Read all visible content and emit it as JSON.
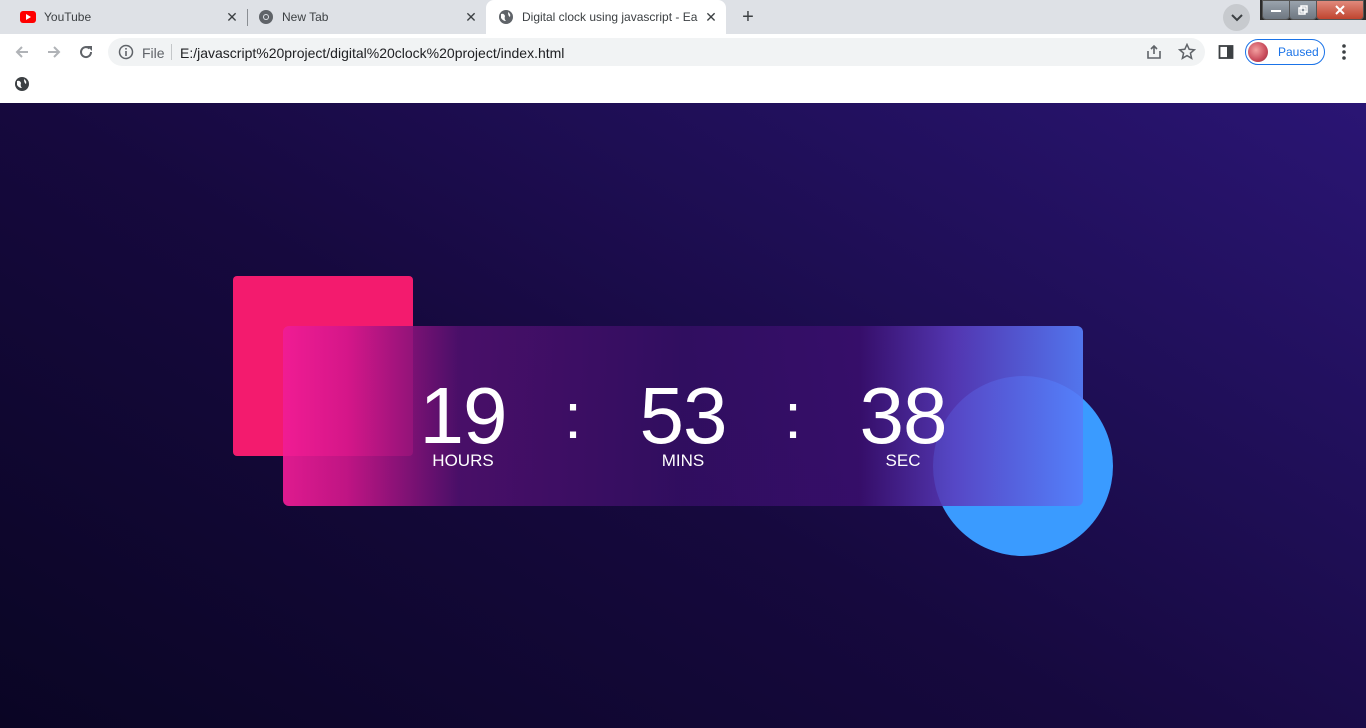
{
  "browser": {
    "tabs": [
      {
        "title": "YouTube",
        "icon": "youtube-icon"
      },
      {
        "title": "New Tab",
        "icon": "chrome-icon"
      },
      {
        "title": "Digital clock using javascript - Ea",
        "icon": "globe-icon",
        "active": true
      }
    ],
    "omnibox": {
      "scheme_label": "File",
      "url": "E:/javascript%20project/digital%20clock%20project/index.html"
    },
    "profile": {
      "label": "Paused"
    }
  },
  "clock": {
    "hours": "19",
    "hours_label": "HOURS",
    "minutes": "53",
    "minutes_label": "MINS",
    "seconds": "38",
    "seconds_label": "SEC",
    "separator": ":"
  },
  "colors": {
    "page_bg_dark": "#0a0524",
    "page_bg_light": "#2a1574",
    "pink_square": "#f31b6e",
    "blue_circle": "#3a9bff",
    "profile_accent": "#1a73e8"
  }
}
